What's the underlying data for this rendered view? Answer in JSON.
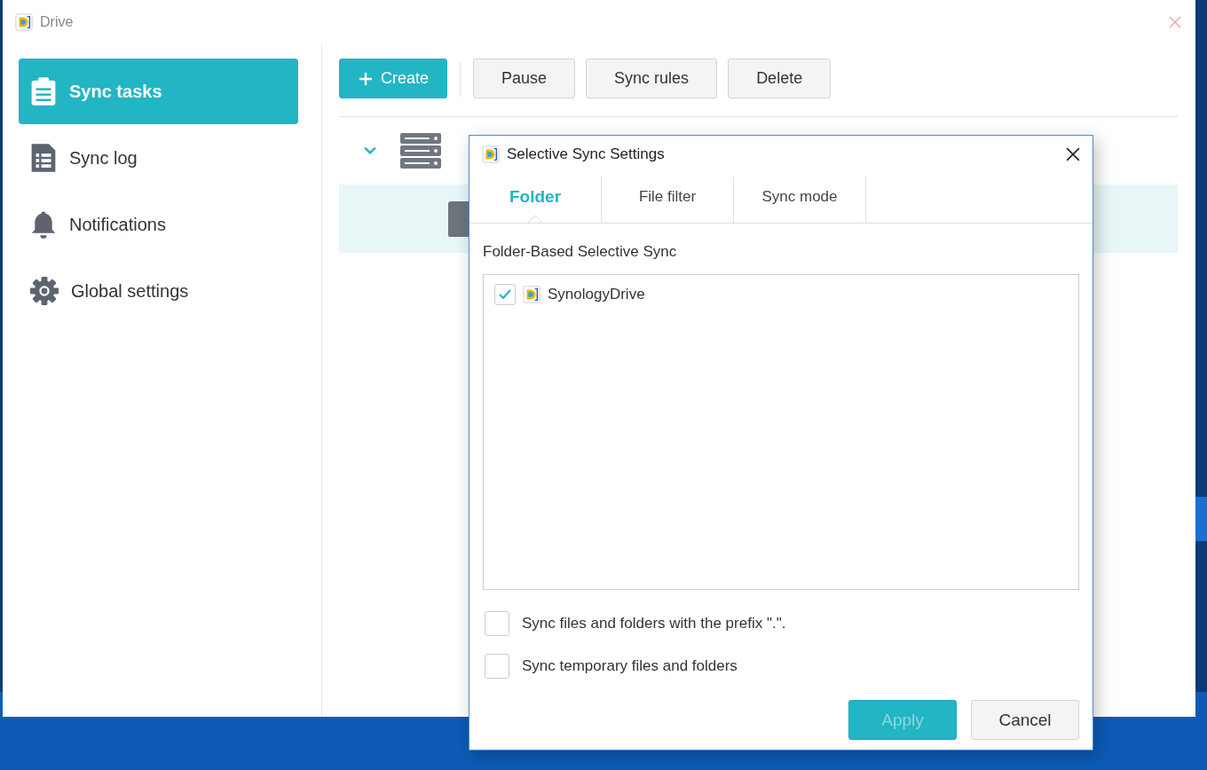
{
  "window": {
    "title": "Drive"
  },
  "sidebar": {
    "items": [
      {
        "label": "Sync tasks",
        "selected": true
      },
      {
        "label": "Sync log",
        "selected": false
      },
      {
        "label": "Notifications",
        "selected": false
      },
      {
        "label": "Global settings",
        "selected": false
      }
    ]
  },
  "toolbar": {
    "buttons": [
      {
        "label": "Create",
        "kind": "primary"
      },
      {
        "label": "Pause",
        "kind": "default"
      },
      {
        "label": "Sync rules",
        "kind": "default"
      },
      {
        "label": "Delete",
        "kind": "default"
      }
    ]
  },
  "task": {
    "expanded": true
  },
  "dialog": {
    "title": "Selective Sync Settings",
    "tabs": [
      {
        "label": "Folder",
        "selected": true
      },
      {
        "label": "File filter",
        "selected": false
      },
      {
        "label": "Sync mode",
        "selected": false
      }
    ],
    "section_label": "Folder-Based Selective Sync",
    "tree": [
      {
        "label": "SynologyDrive",
        "checked": true
      }
    ],
    "options": [
      {
        "label": "Sync files and folders with the prefix \".\".",
        "checked": false
      },
      {
        "label": "Sync temporary files and folders",
        "checked": false
      }
    ],
    "buttons": [
      {
        "label": "Apply",
        "kind": "primary",
        "disabled": true
      },
      {
        "label": "Cancel",
        "kind": "default",
        "disabled": false
      }
    ]
  }
}
